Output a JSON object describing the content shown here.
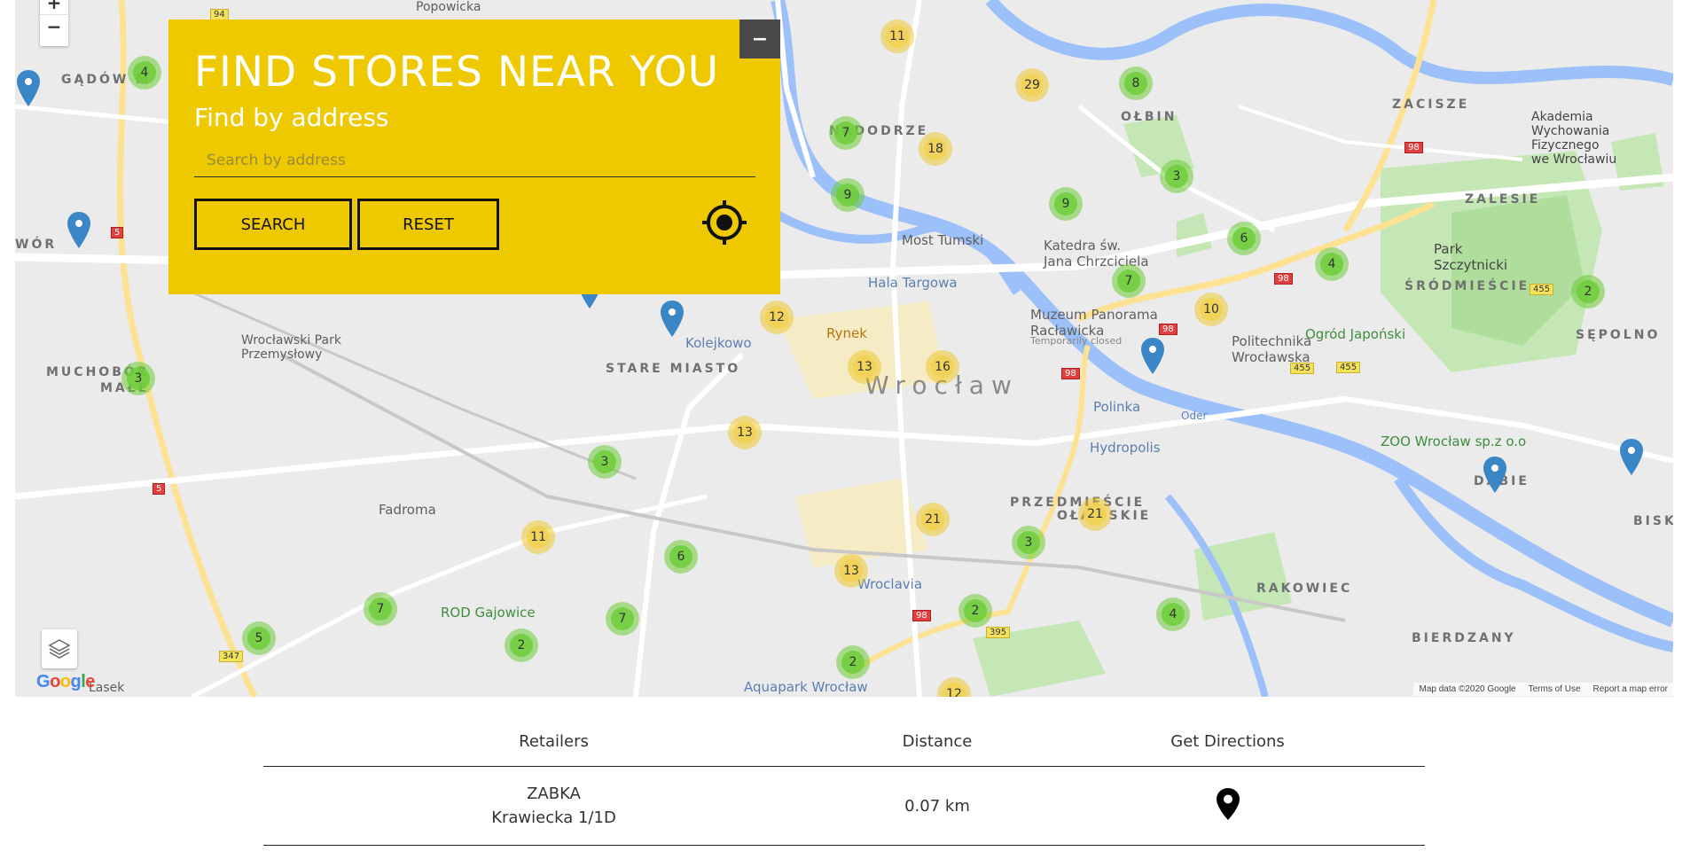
{
  "map": {
    "zoom_in": "+",
    "zoom_out": "−",
    "google": "Google",
    "attribution": {
      "data": "Map data ©2020 Google",
      "terms": "Terms of Use",
      "report": "Report a map error"
    },
    "labels": {
      "gadow": "GĄDÓW M",
      "wor": "WÓR",
      "muchobor": "MUCHOBÓR",
      "male": "MAŁE",
      "nadodrze": "NADODRZE",
      "olbin": "OŁBIN",
      "zacisze": "ZACISZE",
      "zalesie": "ZALESIE",
      "srodmiescie": "ŚRÓDMIEŚCIE",
      "sepolno": "SĘPOLNO",
      "stare_miasto": "STARE MIASTO",
      "wroclaw": "Wrocław",
      "przedmiescie": "PRZEDMIEŚCIE",
      "olawskie": "OŁAWSKIE",
      "rakowiec": "RAKOWIEC",
      "bierdzany": "BIERDZANY",
      "biskupin": "BISK",
      "dabie": "DĄBIE",
      "park": "Wrocławski Park\nPrzemysłowy",
      "kolejkowo": "Kolejkowo",
      "rynek": "Rynek",
      "hala": "Hala Targowa",
      "most": "Most Tumski",
      "katedra": "Katedra św.\nJana Chrzciciela",
      "panorama": "Muzeum Panorama\nRacławicka",
      "temp_closed": "Temporarily closed",
      "politechnika": "Politechnika\nWrocławska",
      "ogrod": "Ogród Japoński",
      "park_szczytnicki": "Park\nSzczytnicki",
      "akademia": "Akademia\nWychowania\nFizycznego\nwe Wrocławiu",
      "polinka": "Polinka",
      "hydropolis": "Hydropolis",
      "zoo": "ZOO Wrocław sp.z o.o",
      "fadroma": "Fadroma",
      "rod": "ROD Gajowice",
      "wroclavia": "Wroclavia",
      "aquapark": "Aquapark Wrocław",
      "lasek": "Lasek",
      "popowicka": "Popowicka",
      "oder": "Oder"
    },
    "clusters": [
      {
        "n": "4",
        "c": "g"
      },
      {
        "n": "3",
        "c": "g"
      },
      {
        "n": "11",
        "c": "y"
      },
      {
        "n": "29",
        "c": "y"
      },
      {
        "n": "8",
        "c": "g"
      },
      {
        "n": "7",
        "c": "g"
      },
      {
        "n": "18",
        "c": "y"
      },
      {
        "n": "9",
        "c": "g"
      },
      {
        "n": "3",
        "c": "g"
      },
      {
        "n": "9",
        "c": "g"
      },
      {
        "n": "6",
        "c": "g"
      },
      {
        "n": "4",
        "c": "g"
      },
      {
        "n": "2",
        "c": "g"
      },
      {
        "n": "7",
        "c": "g"
      },
      {
        "n": "10",
        "c": "y"
      },
      {
        "n": "12",
        "c": "y"
      },
      {
        "n": "13",
        "c": "y"
      },
      {
        "n": "16",
        "c": "y"
      },
      {
        "n": "13",
        "c": "y"
      },
      {
        "n": "3",
        "c": "g"
      },
      {
        "n": "11",
        "c": "y"
      },
      {
        "n": "6",
        "c": "g"
      },
      {
        "n": "21",
        "c": "y"
      },
      {
        "n": "21",
        "c": "y"
      },
      {
        "n": "3",
        "c": "g"
      },
      {
        "n": "13",
        "c": "y"
      },
      {
        "n": "7",
        "c": "g"
      },
      {
        "n": "7",
        "c": "g"
      },
      {
        "n": "2",
        "c": "g"
      },
      {
        "n": "5",
        "c": "g"
      },
      {
        "n": "2",
        "c": "g"
      },
      {
        "n": "2",
        "c": "g"
      },
      {
        "n": "4",
        "c": "g"
      },
      {
        "n": "12",
        "c": "y"
      }
    ],
    "road_numbers": [
      "94",
      "5",
      "5",
      "347",
      "98",
      "98",
      "98",
      "98",
      "455",
      "455",
      "455",
      "98",
      "395"
    ]
  },
  "panel": {
    "title": "FIND STORES NEAR YOU",
    "subtitle": "Find by address",
    "search_placeholder": "Search by address",
    "search_value": "",
    "search_button": "SEARCH",
    "reset_button": "RESET",
    "minimize": "−",
    "accent": "#eec900"
  },
  "results": {
    "headers": {
      "retailers": "Retailers",
      "distance": "Distance",
      "directions": "Get Directions"
    },
    "rows": [
      {
        "retailer": "ZABKA",
        "address": "Krawiecka 1/1D",
        "distance": "0.07 km",
        "directions_icon": "map-pin-icon"
      }
    ]
  }
}
